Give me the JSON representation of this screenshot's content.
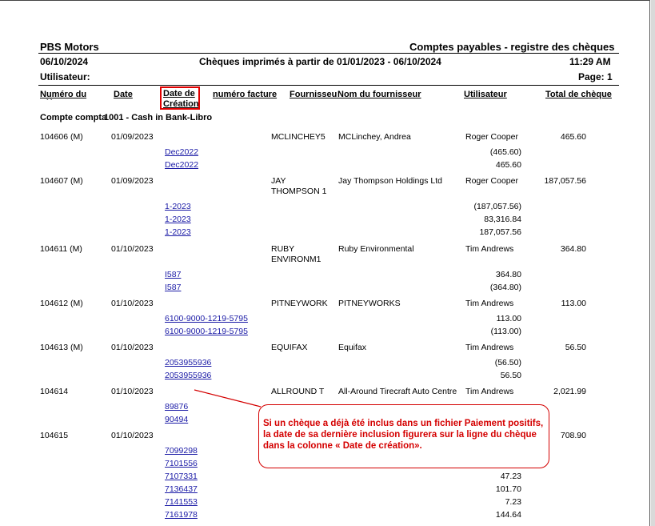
{
  "report": {
    "company": "PBS Motors",
    "title": "Comptes payables - registre des chèques",
    "date": "06/10/2024",
    "subtitle": "Chèques imprimés à partir de 01/01/2023 - 06/10/2024",
    "time": "11:29 AM",
    "user_label": "Utilisateur:",
    "page_label": "Page: 1"
  },
  "columns": {
    "numero_l1": "Numéro du",
    "numero_l2": "` `",
    "date": "Date",
    "creation_l1": "Date de",
    "creation_l2": "Création",
    "facture": "numéro facture",
    "fournisseur": "Fournisseur",
    "nom": "Nom du fournisseur",
    "utilisateur": "Utilisateur",
    "total": "Total de chèque"
  },
  "account": {
    "label": "Compte comptable",
    "value": "1001 - Cash in Bank-Libro"
  },
  "cheques": [
    {
      "num": "104606 (M)",
      "date": "01/09/2023",
      "vendor_l1": "MCLINCHEY5",
      "vendor_l2": "",
      "name": "MCLinchey, Andrea",
      "user": "Roger Cooper",
      "total": "465.60",
      "lines": [
        {
          "invoice": "Dec2022",
          "amount": "(465.60)"
        },
        {
          "invoice": "Dec2022",
          "amount": "465.60"
        }
      ]
    },
    {
      "num": "104607 (M)",
      "date": "01/09/2023",
      "vendor_l1": "JAY",
      "vendor_l2": "THOMPSON 1",
      "name": "Jay Thompson Holdings Ltd",
      "user": "Roger Cooper",
      "total": "187,057.56",
      "lines": [
        {
          "invoice": "1-2023",
          "amount": "(187,057.56)"
        },
        {
          "invoice": "1-2023",
          "amount": "83,316.84"
        },
        {
          "invoice": "1-2023",
          "amount": "187,057.56"
        }
      ]
    },
    {
      "num": "104611 (M)",
      "date": "01/10/2023",
      "vendor_l1": "RUBY",
      "vendor_l2": "ENVIRONM1",
      "name": "Ruby Environmental",
      "user": "Tim Andrews",
      "total": "364.80",
      "lines": [
        {
          "invoice": "I587",
          "amount": "364.80"
        },
        {
          "invoice": "I587",
          "amount": "(364.80)"
        }
      ]
    },
    {
      "num": "104612 (M)",
      "date": "01/10/2023",
      "vendor_l1": "PITNEYWORK",
      "vendor_l2": "",
      "name": "PITNEYWORKS",
      "user": "Tim Andrews",
      "total": "113.00",
      "lines": [
        {
          "invoice": "6100-9000-1219-5795",
          "amount": "113.00"
        },
        {
          "invoice": "6100-9000-1219-5795",
          "amount": "(113.00)"
        }
      ]
    },
    {
      "num": "104613 (M)",
      "date": "01/10/2023",
      "vendor_l1": "EQUIFAX",
      "vendor_l2": "",
      "name": "Equifax",
      "user": "Tim Andrews",
      "total": "56.50",
      "lines": [
        {
          "invoice": "2053955936",
          "amount": "(56.50)"
        },
        {
          "invoice": "2053955936",
          "amount": "56.50"
        }
      ]
    },
    {
      "num": "104614",
      "date": "01/10/2023",
      "vendor_l1": "ALLROUND T",
      "vendor_l2": "",
      "name": "All-Around Tirecraft Auto Centre",
      "user": "Tim Andrews",
      "total": "2,021.99",
      "lines": [
        {
          "invoice": "89876",
          "amount": ""
        },
        {
          "invoice": "90494",
          "amount": ""
        }
      ]
    },
    {
      "num": "104615",
      "date": "01/10/2023",
      "vendor_l1": "",
      "vendor_l2": "",
      "name": "",
      "user": "",
      "total": "708.90",
      "lines": [
        {
          "invoice": "7099298",
          "amount": ""
        },
        {
          "invoice": "7101556",
          "amount": ""
        },
        {
          "invoice": "7107331",
          "amount": "47.23"
        },
        {
          "invoice": "7136437",
          "amount": "101.70"
        },
        {
          "invoice": "7141553",
          "amount": "7.23"
        },
        {
          "invoice": "7161978",
          "amount": "144.64"
        }
      ]
    }
  ],
  "callout": {
    "text": "Si un chèque a déjà été inclus dans un fichier Paiement positifs, la date de sa dernière inclusion figurera sur la ligne du chèque dans la colonne « Date de création»."
  },
  "colors": {
    "link": "#1a1aa6",
    "highlight": "#e00000",
    "callout": "#d40000"
  }
}
